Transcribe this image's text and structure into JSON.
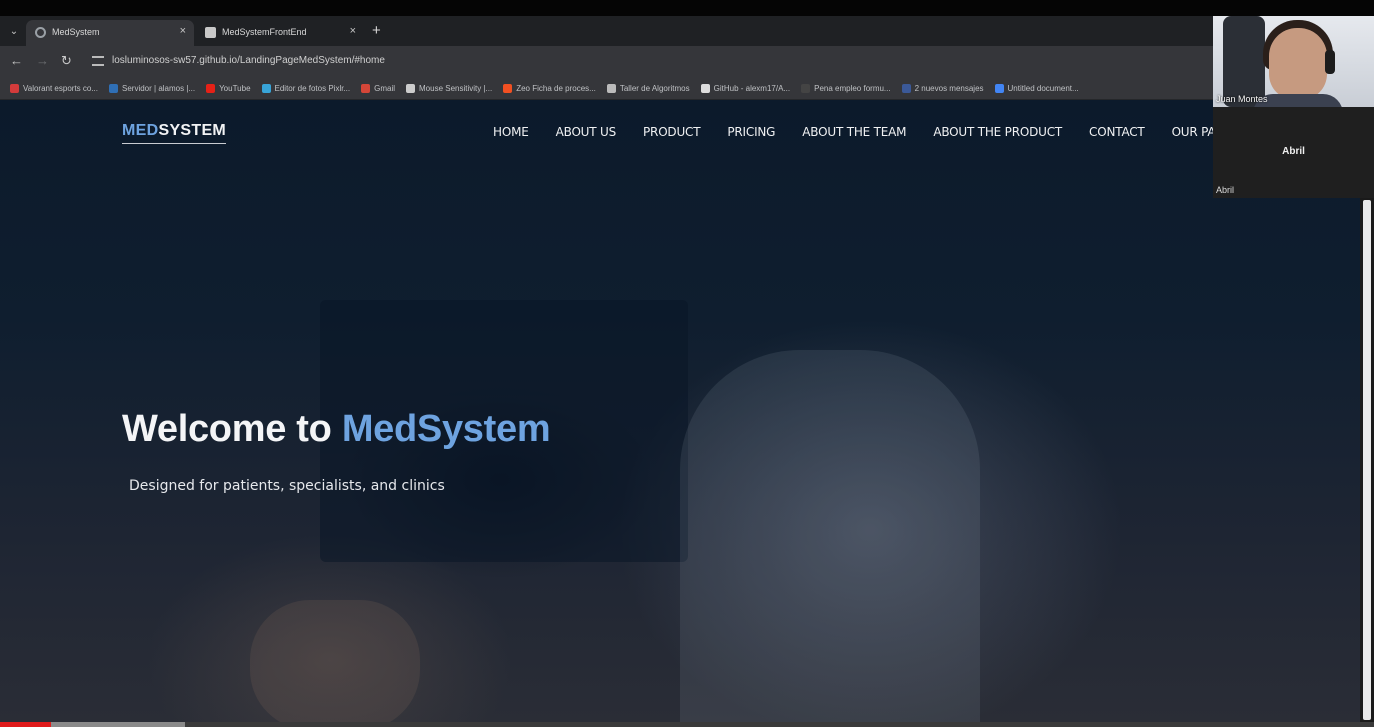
{
  "browser": {
    "tabs": [
      {
        "title": "MedSystem",
        "active": true,
        "close": "×"
      },
      {
        "title": "MedSystemFrontEnd",
        "active": false,
        "close": "×"
      }
    ],
    "menu_glyph": "⌄",
    "new_tab_glyph": "+",
    "nav": {
      "back": "←",
      "forward": "→",
      "reload": "↻"
    },
    "url": "losluminosos-sw57.github.io/LandingPageMedSystem/#home",
    "bookmarks": [
      {
        "label": "Valorant esports co...",
        "color": "#d33b3b"
      },
      {
        "label": "Servidor | alamos |...",
        "color": "#2f6fb5"
      },
      {
        "label": "YouTube",
        "color": "#e62117"
      },
      {
        "label": "Editor de fotos Pixlr...",
        "color": "#38a4d8"
      },
      {
        "label": "Gmail",
        "color": "#d44638"
      },
      {
        "label": "Mouse Sensitivity |...",
        "color": "#cccccc"
      },
      {
        "label": "Zeo Ficha de proces...",
        "color": "#f25022"
      },
      {
        "label": "Taller de Algoritmos",
        "color": "#bbbbbb"
      },
      {
        "label": "GitHub - alexm17/A...",
        "color": "#dddddd"
      },
      {
        "label": "Pena empleo formu...",
        "color": "#444444"
      },
      {
        "label": "2 nuevos mensajes",
        "color": "#3b5998"
      },
      {
        "label": "Untitled document...",
        "color": "#4285f4"
      }
    ]
  },
  "site": {
    "logo_part1": "MED",
    "logo_part2": "SYSTEM",
    "nav": [
      "HOME",
      "ABOUT US",
      "PRODUCT",
      "PRICING",
      "ABOUT THE TEAM",
      "ABOUT THE PRODUCT",
      "CONTACT",
      "OUR PA"
    ],
    "hero": {
      "title_prefix": "Welcome to ",
      "title_highlight": "MedSystem",
      "subtitle": "Designed for patients, specialists, and clinics"
    }
  },
  "call": {
    "self_name": "Juan Montes",
    "other_center": "Abril",
    "other_name": "Abril"
  },
  "player": {
    "progress_fraction": 0.037,
    "buffered_fraction": 0.135,
    "accent": "#e01b1b"
  },
  "colors": {
    "accent_blue": "#6ea3e0"
  }
}
